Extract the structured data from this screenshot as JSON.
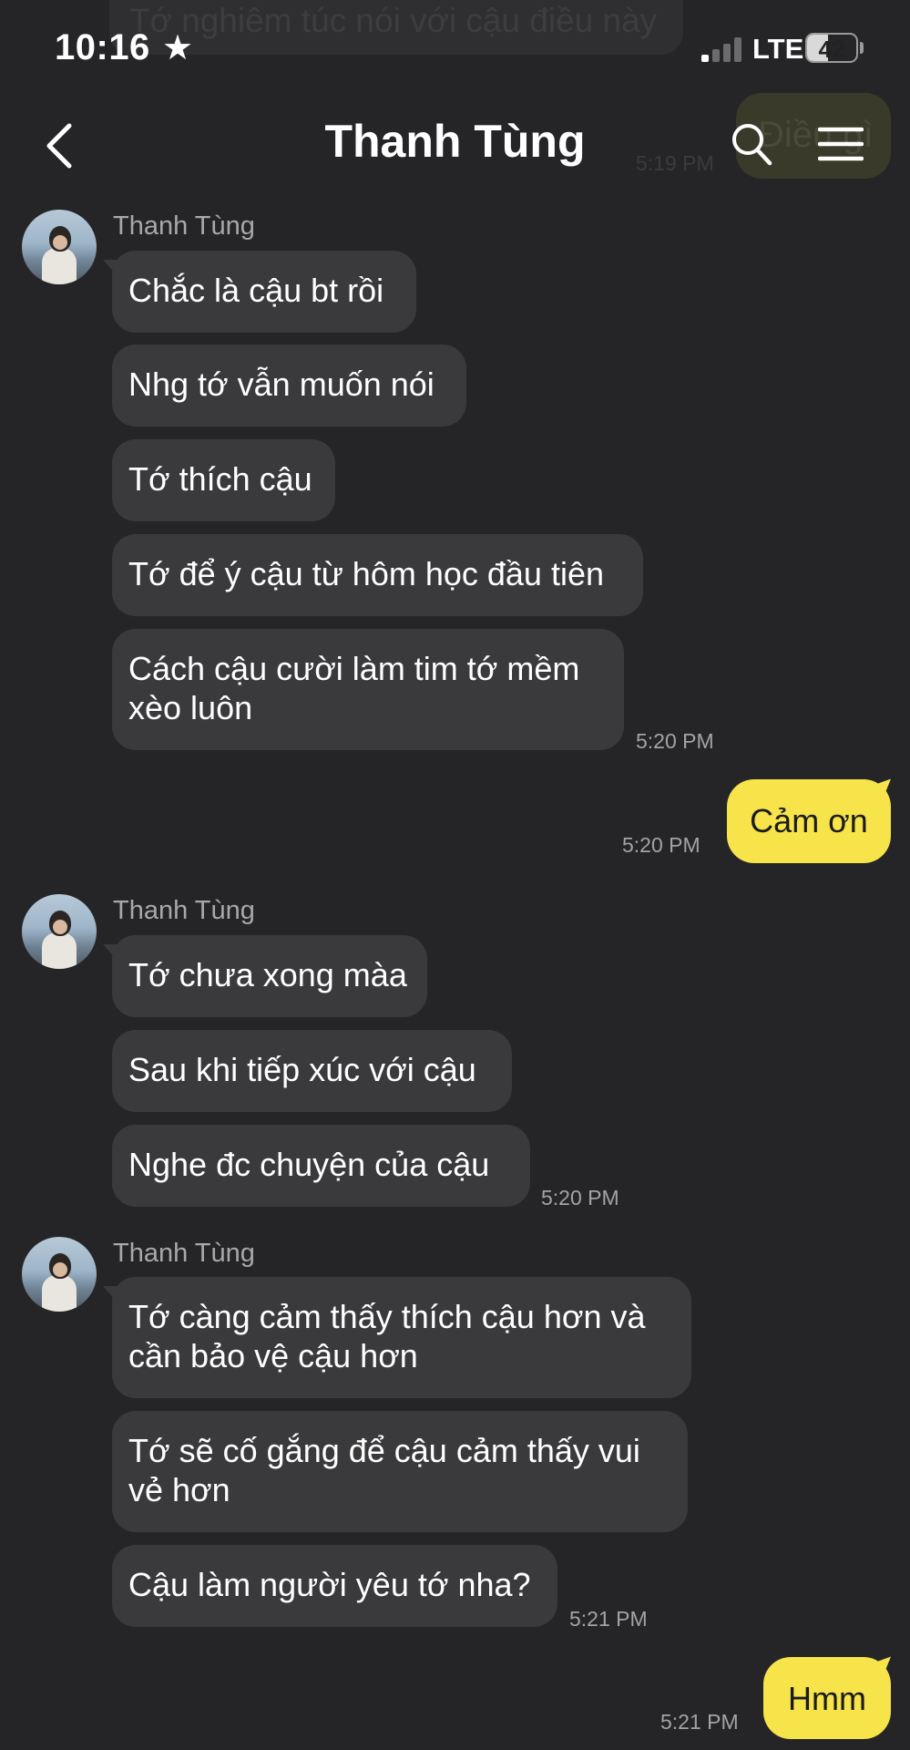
{
  "background_ghost": {
    "top_bubble_text": "Tớ nghiêm túc nói với cậu điều này",
    "yellow_bubble_text": "Điều gì",
    "time": "5:19 PM"
  },
  "status_bar": {
    "time": "10:16",
    "network": "LTE",
    "battery_level": "42",
    "signal_bars_active": 1,
    "signal_bars_total": 4
  },
  "header": {
    "title": "Thanh Tùng",
    "back_icon": "chevron-left-icon",
    "search_icon": "search-icon",
    "menu_icon": "hamburger-menu-icon"
  },
  "colors": {
    "background": "#252527",
    "incoming_bubble": "#3a3a3c",
    "outgoing_bubble": "#f7e44a",
    "timestamp": "#a3a3a6"
  },
  "messages": {
    "group1": {
      "sender": "Thanh Tùng",
      "m1": "Chắc là cậu bt rồi",
      "m2": "Nhg tớ vẫn muốn nói",
      "m3": "Tớ thích cậu",
      "m4": "Tớ để ý cậu từ hôm học đầu tiên",
      "m5": "Cách cậu cười làm tim tớ mềm xèo luôn",
      "time": "5:20 PM"
    },
    "out1": {
      "text": "Cảm ơn",
      "time": "5:20 PM"
    },
    "group2": {
      "sender": "Thanh Tùng",
      "m1": "Tớ chưa xong màa",
      "m2": "Sau khi tiếp xúc với cậu",
      "m3": "Nghe đc chuyện của cậu",
      "time": "5:20 PM"
    },
    "group3": {
      "sender": "Thanh Tùng",
      "m1": "Tớ càng cảm thấy thích cậu hơn và cần bảo vệ cậu hơn",
      "m2": "Tớ sẽ cố gắng để cậu cảm thấy vui vẻ hơn",
      "m3": "Cậu làm người yêu tớ nha?",
      "time": "5:21 PM"
    },
    "out2": {
      "text": "Hmm",
      "time": "5:21 PM"
    }
  }
}
